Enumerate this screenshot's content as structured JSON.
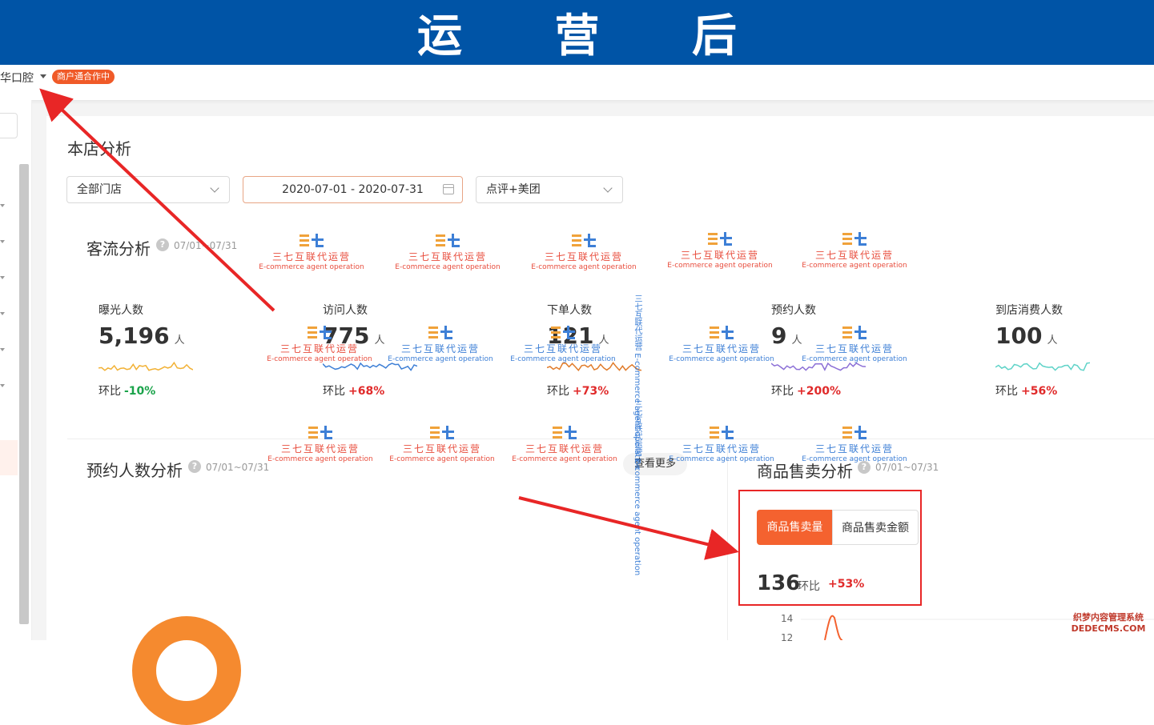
{
  "banner": {
    "title": "运 营 后"
  },
  "topbar": {
    "store_name": "华口腔",
    "badge": "商户通合作中"
  },
  "page": {
    "title": "本店分析"
  },
  "filters": {
    "store": "全部门店",
    "date_range": "2020-07-01 - 2020-07-31",
    "platform": "点评+美团"
  },
  "traffic": {
    "title": "客流分析",
    "range": "07/01~07/31",
    "ratio_label": "环比",
    "metrics": [
      {
        "label": "曝光人数",
        "value": "5,196",
        "unit": "人",
        "ratio": "-10%",
        "color": "#f2b134"
      },
      {
        "label": "访问人数",
        "value": "775",
        "unit": "人",
        "ratio": "+68%",
        "color": "#3d7fd6"
      },
      {
        "label": "下单人数",
        "value": "121",
        "unit": "人",
        "ratio": "+73%",
        "color": "#e07b2a"
      },
      {
        "label": "预约人数",
        "value": "9",
        "unit": "人",
        "ratio": "+200%",
        "color": "#8b6fd6"
      },
      {
        "label": "到店消费人数",
        "value": "100",
        "unit": "人",
        "ratio": "+56%",
        "color": "#5fd3c8"
      }
    ]
  },
  "booking": {
    "title": "预约人数分析",
    "range": "07/01~07/31",
    "more": "查看更多"
  },
  "sales": {
    "title": "商品售卖分析",
    "range": "07/01~07/31",
    "tab_active": "商品售卖量",
    "tab_inactive": "商品售卖金额",
    "value": "136",
    "ratio_label": "环比",
    "ratio": "+53%",
    "y_ticks": [
      "14",
      "12"
    ]
  },
  "watermark": {
    "cn": "三七互联代运营",
    "en": "E-commerce agent operation"
  },
  "corner_watermark": {
    "line1": "织梦内容管理系统",
    "line2": "DEDECMS.COM"
  },
  "colors": {
    "banner": "#0054a6",
    "accent": "#f4622f",
    "up": "#e02a2a",
    "down": "#1aa34a"
  }
}
